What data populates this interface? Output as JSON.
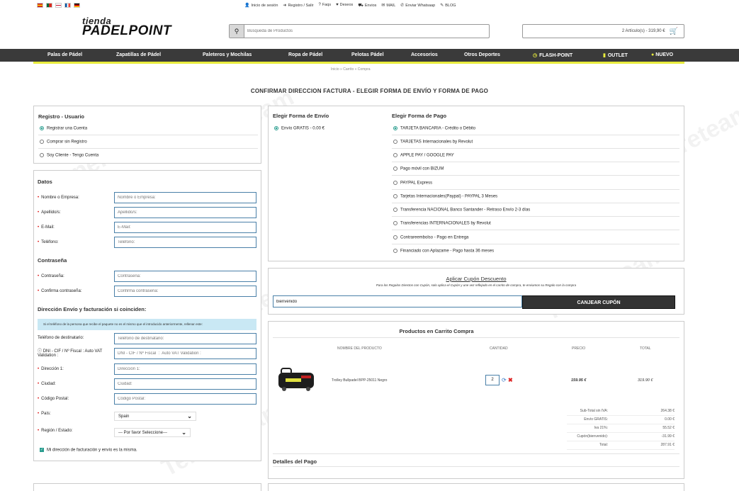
{
  "header": {
    "top_links": [
      {
        "icon": "user-icon",
        "glyph": "👤",
        "label": "Inicio de sesión"
      },
      {
        "icon": "login-icon",
        "glyph": "➜",
        "label": "Registro / Salir"
      },
      {
        "icon": "question-icon",
        "glyph": "?",
        "label": "Faqs"
      },
      {
        "icon": "heart-icon",
        "glyph": "♥",
        "label": "Deseos"
      },
      {
        "icon": "truck-icon",
        "glyph": "⛟",
        "label": "Envios"
      },
      {
        "icon": "mail-icon",
        "glyph": "✉",
        "label": "MAIL"
      },
      {
        "icon": "chat-icon",
        "glyph": "✆",
        "label": "Enviar Whatsaap"
      },
      {
        "icon": "pencil-icon",
        "glyph": "✎",
        "label": "BLOG"
      }
    ],
    "logo_top": "tienda",
    "logo_main": "PADELPOINT",
    "search_placeholder": "Búsqueda de Productos",
    "cart_summary": "2 Artículo(s) - 319,90 €"
  },
  "nav": [
    {
      "label": "Palas de Pádel"
    },
    {
      "label": "Zapatillas de Pádel"
    },
    {
      "label": "Paleteros y Mochilas"
    },
    {
      "label": "Ropa de Pádel"
    },
    {
      "label": "Pelotas Pádel"
    },
    {
      "label": "Accesorios"
    },
    {
      "label": "Otros Deportes"
    },
    {
      "label": "FLASH-POINT"
    },
    {
      "label": "OUTLET"
    },
    {
      "label": "NUEVO"
    }
  ],
  "breadcrumb": "Inicio  »  Carrito  »  Compra",
  "page_title": "CONFIRMAR DIRECCION FACTURA - ELEGIR FORMA DE ENVÍO Y FORMA DE PAGO",
  "registro": {
    "title": "Registro - Usuario",
    "options": [
      "Registrar una Cuenta",
      "Comprar sin Registro",
      "Soy Cliente - Tengo Cuenta"
    ]
  },
  "datos": {
    "title": "Datos",
    "fields": [
      {
        "label": "Nombre o Empresa:",
        "placeholder": "Nombre o Empresa:"
      },
      {
        "label": "Apellido/s:",
        "placeholder": "Apellido/s:"
      },
      {
        "label": "E-Mail:",
        "placeholder": "E-Mail:"
      },
      {
        "label": "Teléfono:",
        "placeholder": "Teléfono:"
      }
    ],
    "password_title": "Contraseña",
    "password_fields": [
      {
        "label": "Contraseña:",
        "placeholder": "Contraseña:"
      },
      {
        "label": "Confirma contraseña:",
        "placeholder": "Confirma contraseña:"
      }
    ],
    "address_title": "Dirección Envío y facturación si coinciden:",
    "info_text": "Si el teléfono de la persona que recibe el paquete no es el mismo que el introducido anteriormente, rellenar este:",
    "address_fields": [
      {
        "label": "Teléfono de destinatario:",
        "placeholder": "Teléfono de destinatario:",
        "req": false
      },
      {
        "label": "DNI - CIF / Nº Fiscal : Auto VAT Validation :",
        "placeholder": "DNI - CIF / Nº Fiscal  :  Auto VAT Validation :",
        "req": false
      },
      {
        "label": "Dirección 1:",
        "placeholder": "Dirección 1:",
        "req": true
      },
      {
        "label": "Ciudad:",
        "placeholder": "Ciudad:",
        "req": true
      },
      {
        "label": "Código Postal:",
        "placeholder": "Código Postal:",
        "req": true
      }
    ],
    "country_label": "País:",
    "country_value": "Spain",
    "region_label": "Región / Estado:",
    "region_value": "--- Por favor Seleccione---",
    "same_address_label": "Mi dirección de facturación y envío es la misma."
  },
  "shipping": {
    "title": "Elegir Forma de Envío",
    "options": [
      "Envío GRATIS - 0.00 €"
    ]
  },
  "payment": {
    "title": "Elegir Forma de Pago",
    "options": [
      "TARJETA BANCARIA - Crédito o Débito",
      "TARJETAS Internacionales by Revolut",
      "APPLE PAY / GOOGLE PAY",
      "Pago móvil con BIZUM",
      "PAYPAL Express",
      "Tarjetas Internacionales(Paypal) - PAYPAL 3 Meses",
      "Transferencia NACIONAL Banco Santander - Retraso Envío 2-3 días",
      "Transferencias INTERNACIONALES by Revolut",
      "Contrareembolso - Pago en Entrega",
      "Financiado con Aplazame - Pago hasta 36 meses"
    ]
  },
  "coupon": {
    "title": "Aplicar Cupón Descuento",
    "note": "Para los Regalos Directos con Cupón, solo aplica el Cupón y une vez reflejado en el carrito de compra, te enviamos su Regalo con la compra",
    "value": "bienvenido",
    "button": "CANJEAR CUPÓN"
  },
  "cart": {
    "title": "Productos en Carrito Compra",
    "headers": [
      "NOMBRE DEL PRODUCTO",
      "CANTIDAD",
      "PRECIO",
      "TOTAL"
    ],
    "item": {
      "name": "Trolley Bullpadel BPP-25011 Negro",
      "qty": "2",
      "price": "159.95 €",
      "total": "319.90 €"
    },
    "totals": [
      {
        "label": "Sub-Total sin IVA:",
        "value": "264.38 €"
      },
      {
        "label": "Envío GRATIS:",
        "value": "0.00 €"
      },
      {
        "label": "Iva 21%:",
        "value": "55.52 €"
      },
      {
        "label": "Cupón(bienvenido):",
        "value": "-31.99 €"
      },
      {
        "label": "Total:",
        "value": "287.91 €"
      }
    ]
  },
  "payment_details_title": "Detalles del Pago",
  "watermark": "Tenereteam",
  "colors": {
    "nav_bg": "#3a3a3a",
    "accent_yellow": "#e8ec3c",
    "radio_on": "#2a9d8f",
    "field_border": "#4a80a8"
  }
}
